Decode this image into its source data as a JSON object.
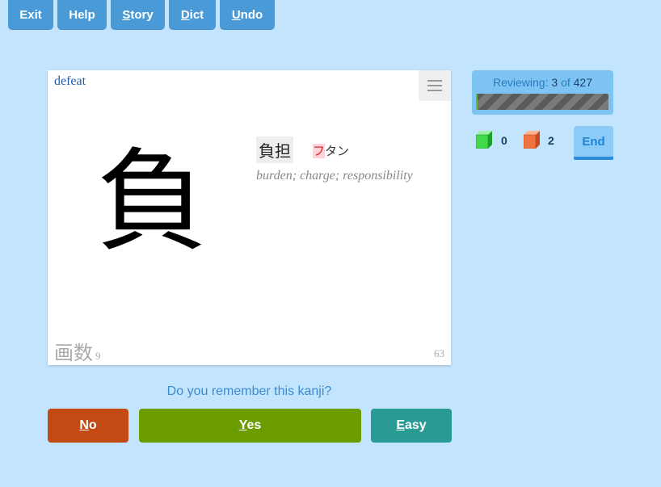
{
  "toolbar": {
    "exit": "Exit",
    "help": "Help",
    "story": {
      "key": "S",
      "rest": "tory"
    },
    "dict": {
      "key": "D",
      "rest": "ict"
    },
    "undo": {
      "key": "U",
      "rest": "ndo"
    }
  },
  "card": {
    "keyword": "defeat",
    "kanji": "負",
    "vocab": {
      "word": "負担",
      "reading_highlight": "フ",
      "reading_rest": "タン",
      "meaning": "burden; charge; responsibility"
    },
    "stroke_label": "画数",
    "stroke_count": "9",
    "frame_number": "63"
  },
  "question": "Do you remember this kanji?",
  "answers": {
    "no": {
      "key": "N",
      "rest": "o"
    },
    "yes": {
      "key": "Y",
      "rest": "es"
    },
    "easy": {
      "key": "E",
      "rest": "asy"
    }
  },
  "review": {
    "label": "Reviewing:",
    "current": "3",
    "of": "of",
    "total": "427",
    "progress": 0.007
  },
  "stats": {
    "known_count": "0",
    "failed_count": "2"
  },
  "end_label": "End",
  "colors": {
    "background": "#c3e4fd",
    "toolbar_button": "#4a9ad8",
    "no_button": "#c34a12",
    "yes_button": "#6b9c00",
    "easy_button": "#2a9a94",
    "known_cube": "#3fd94a",
    "failed_cube": "#f07242",
    "progress_fill": "#6ab53a"
  }
}
